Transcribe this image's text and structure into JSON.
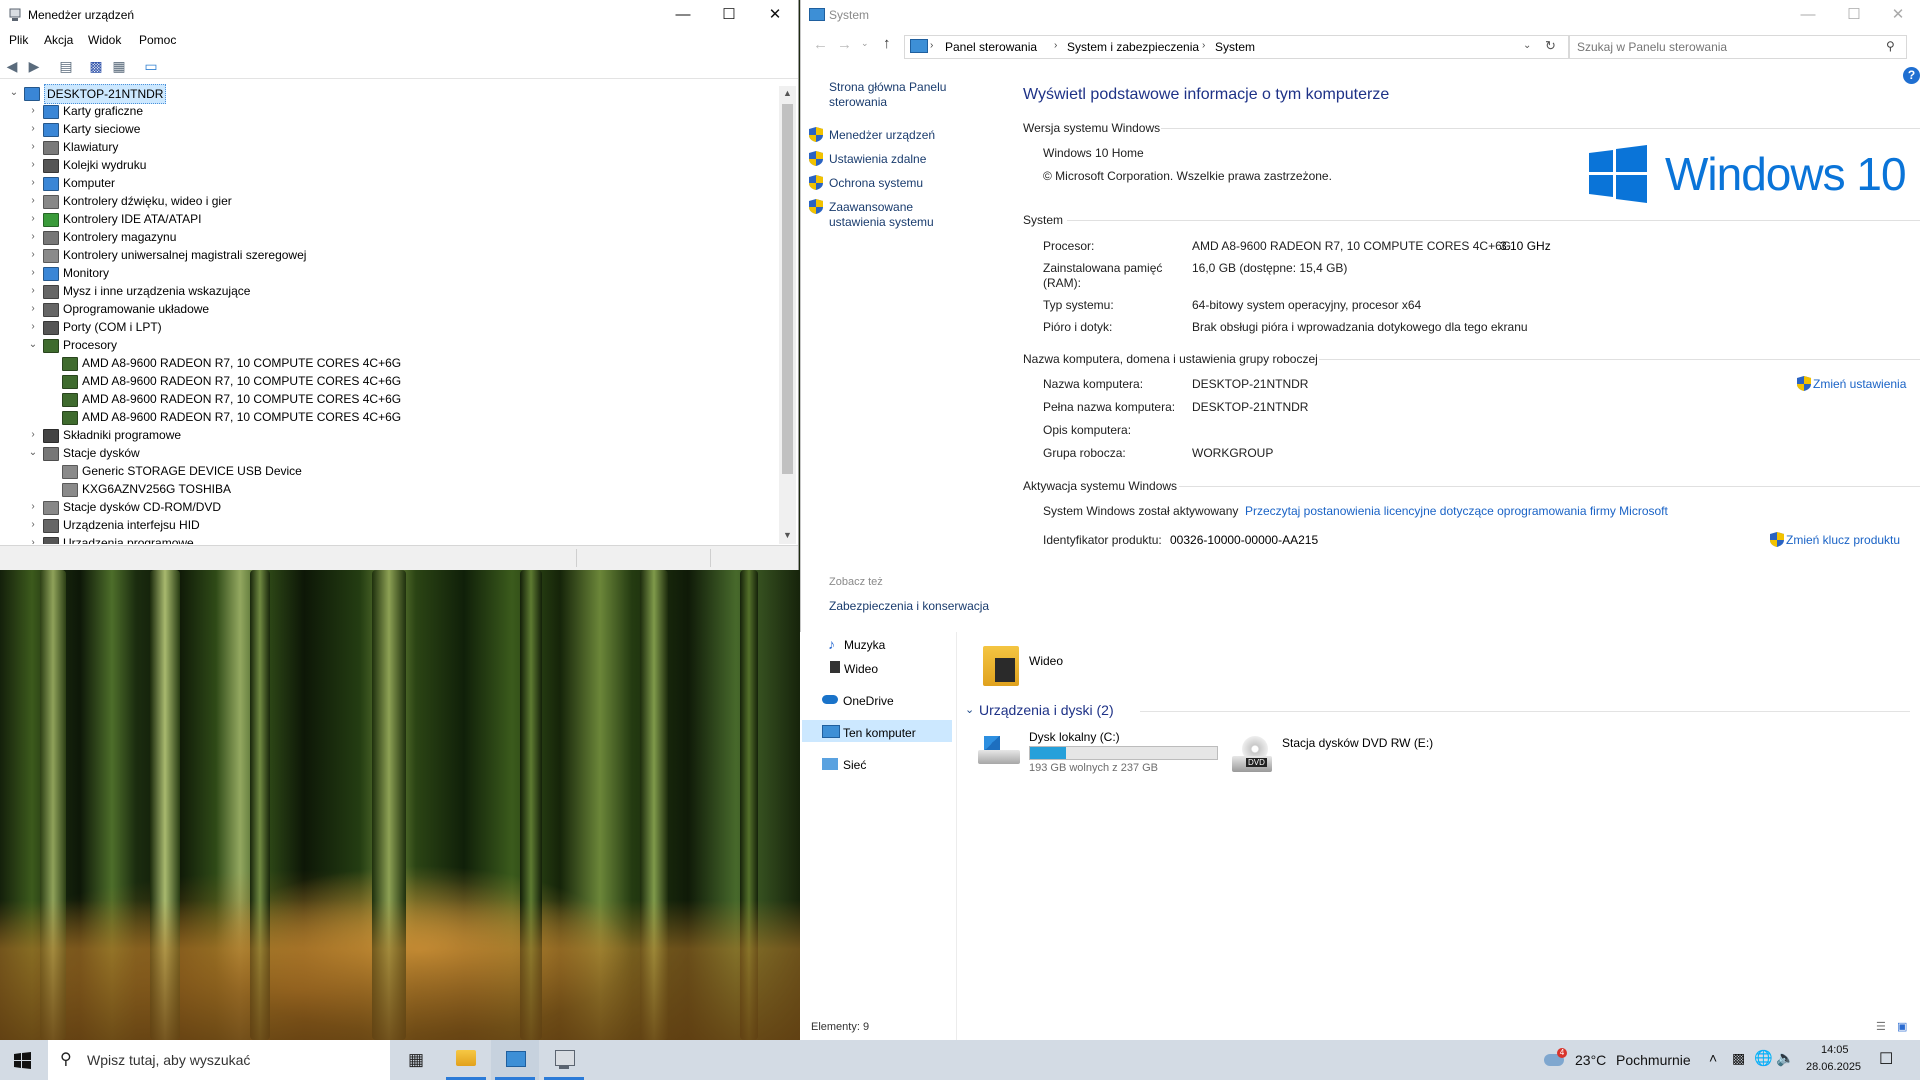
{
  "device_manager": {
    "title": "Menedżer urządzeń",
    "menu": [
      "Plik",
      "Akcja",
      "Widok",
      "Pomoc"
    ],
    "computer_name": "DESKTOP-21NTNDR",
    "categories": [
      "Karty graficzne",
      "Karty sieciowe",
      "Klawiatury",
      "Kolejki wydruku",
      "Komputer",
      "Kontrolery dźwięku, wideo i gier",
      "Kontrolery IDE ATA/ATAPI",
      "Kontrolery magazynu",
      "Kontrolery uniwersalnej magistrali szeregowej",
      "Monitory",
      "Mysz i inne urządzenia wskazujące",
      "Oprogramowanie układowe",
      "Porty (COM i LPT)",
      "Procesory",
      "AMD A8-9600 RADEON R7, 10 COMPUTE CORES 4C+6G",
      "AMD A8-9600 RADEON R7, 10 COMPUTE CORES 4C+6G",
      "AMD A8-9600 RADEON R7, 10 COMPUTE CORES 4C+6G",
      "AMD A8-9600 RADEON R7, 10 COMPUTE CORES 4C+6G",
      "Składniki programowe",
      "Stacje dysków",
      "Generic STORAGE DEVICE USB Device",
      "KXG6AZNV256G TOSHIBA",
      "Stacje dysków CD-ROM/DVD",
      "Urządzenia interfejsu HID",
      "Urządzenia programowe"
    ]
  },
  "system": {
    "title": "System",
    "breadcrumb": [
      "Panel sterowania",
      "System i zabezpieczenia",
      "System"
    ],
    "search_placeholder": "Szukaj w Panelu sterowania",
    "help": "?",
    "left_nav": {
      "home": "Strona główna Panelu sterowania",
      "links": [
        "Menedżer urządzeń",
        "Ustawienia zdalne",
        "Ochrona systemu",
        "Zaawansowane ustawienia systemu"
      ],
      "see_also": "Zobacz też",
      "see_also_link": "Zabezpieczenia i konserwacja"
    },
    "heading": "Wyświetl podstawowe informacje o tym komputerze",
    "edition_section": "Wersja systemu Windows",
    "edition": "Windows 10 Home",
    "copyright": "© Microsoft Corporation. Wszelkie prawa zastrzeżone.",
    "logo_text": "Windows 10",
    "system_section": "System",
    "processor_label": "Procesor:",
    "processor_value": "AMD A8-9600 RADEON R7, 10 COMPUTE CORES 4C+6G",
    "processor_speed": "3.10 GHz",
    "ram_label": "Zainstalowana pamięć (RAM):",
    "ram_value": "16,0 GB (dostępne: 15,4 GB)",
    "type_label": "Typ systemu:",
    "type_value": "64-bitowy system operacyjny, procesor x64",
    "pen_label": "Pióro i dotyk:",
    "pen_value": "Brak obsługi pióra i wprowadzania dotykowego dla tego ekranu",
    "name_section": "Nazwa komputera, domena i ustawienia grupy roboczej",
    "name_label": "Nazwa komputera:",
    "name_value": "DESKTOP-21NTNDR",
    "fullname_label": "Pełna nazwa komputera:",
    "fullname_value": "DESKTOP-21NTNDR",
    "desc_label": "Opis komputera:",
    "workgroup_label": "Grupa robocza:",
    "workgroup_value": "WORKGROUP",
    "change_settings": "Zmień ustawienia",
    "activation_section": "Aktywacja systemu Windows",
    "activated_text": "System Windows został aktywowany",
    "license_link": "Przeczytaj postanowienia licencyjne dotyczące oprogramowania firmy Microsoft",
    "product_id_label": "Identyfikator produktu:",
    "product_id_value": "00326-10000-00000-AA215",
    "change_key": "Zmień klucz produktu"
  },
  "explorer": {
    "nav": [
      "Muzyka",
      "Wideo",
      "OneDrive",
      "Ten komputer",
      "Sieć"
    ],
    "folder_video": "Wideo",
    "devices_header": "Urządzenia i dyski (2)",
    "drive_c_name": "Dysk lokalny (C:)",
    "drive_c_free": "193 GB wolnych z 237 GB",
    "drive_c_used_fraction": 0.19,
    "dvd_name": "Stacja dysków DVD RW (E:)",
    "dvd_badge": "DVD",
    "status": "Elementy: 9"
  },
  "taskbar": {
    "search_placeholder": "Wpisz tutaj, aby wyszukać",
    "weather_temp": "23°C",
    "weather_desc": "Pochmurnie",
    "weather_badge": "4",
    "time": "14:05",
    "date": "28.06.2025"
  }
}
